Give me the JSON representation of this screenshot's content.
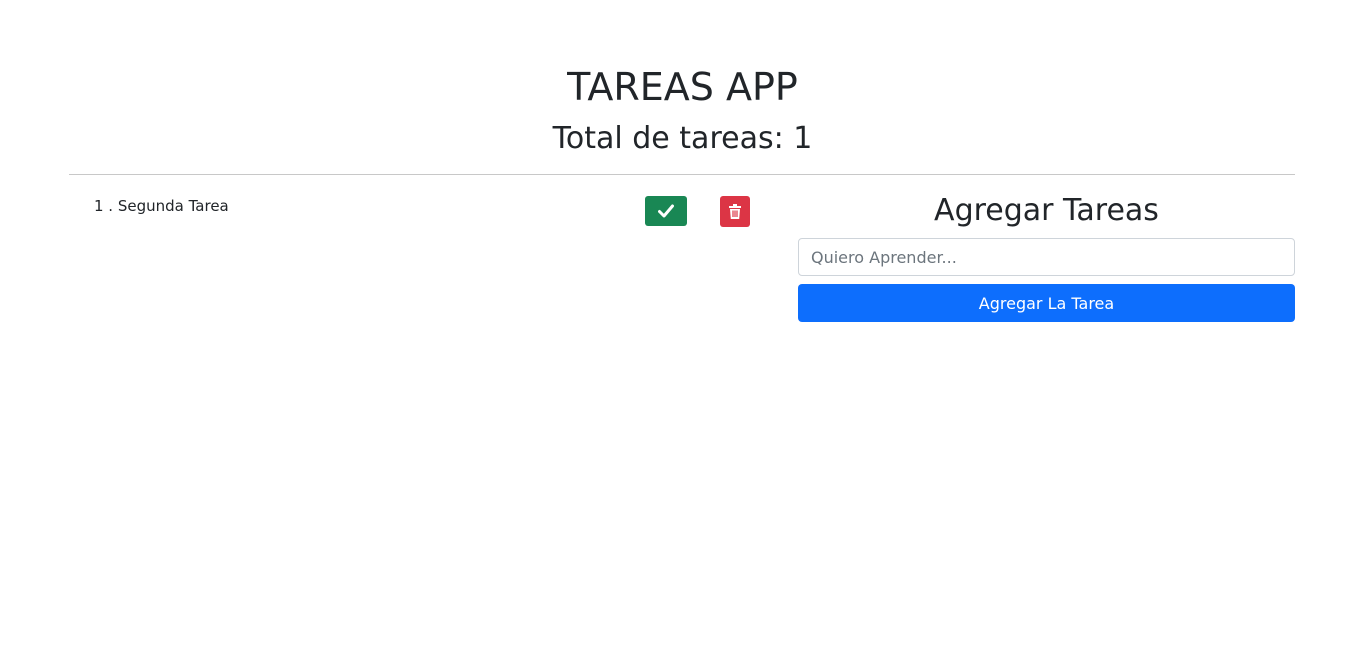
{
  "header": {
    "title": "TAREAS APP",
    "total_label": "Total de tareas: 1"
  },
  "tasks": [
    {
      "label": "1 . Segunda Tarea",
      "done_icon": "check-icon",
      "delete_icon": "trash-icon"
    }
  ],
  "form": {
    "title": "Agregar Tareas",
    "input_placeholder": "Quiero Aprender...",
    "input_value": "",
    "submit_label": "Agregar La Tarea"
  },
  "colors": {
    "done": "#198754",
    "delete": "#dc3545",
    "primary": "#0d6efd"
  }
}
